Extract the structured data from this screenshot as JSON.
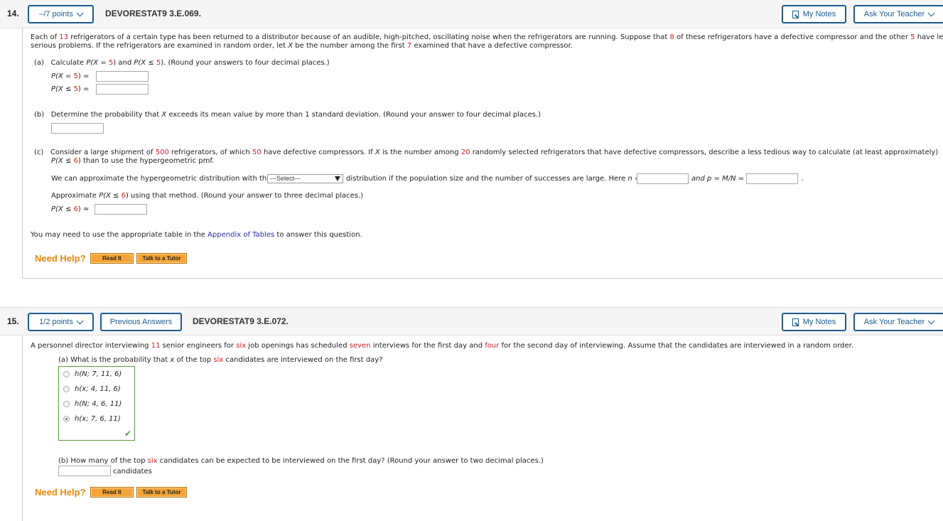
{
  "q14": {
    "number": "14.",
    "points_label": "–/7 points",
    "code": "DEVORESTAT9 3.E.069.",
    "my_notes": "My Notes",
    "ask_teacher": "Ask Your Teacher",
    "intro": {
      "p1": "Each of ",
      "n_total": "13",
      "p2": " refrigerators of a certain type has been returned to a distributor because of an audible, high-pitched, oscillating noise when the refrigerators are running. Suppose that ",
      "n_defective": "8",
      "p3": " of these refrigerators have a defective compressor and the other ",
      "n_other": "5",
      "p4": " have less",
      "line2_a": "serious problems. If the refrigerators are examined in random order, let ",
      "var": "X",
      "line2_b": " be the number among the first ",
      "n_first": "7",
      "line2_c": " examined that have a defective compressor."
    },
    "part_a": {
      "label": "(a)",
      "text_a": "Calculate ",
      "expr1": "P(X = ",
      "val": "5",
      "expr_close": ")",
      "and": " and ",
      "expr2": "P(X ≤ ",
      "text_b": ". (Round your answers to four decimal places.)",
      "row1_label": "P(X = ",
      "row2_label": "P(X ≤ ",
      "eq": ") =",
      "answer1": "",
      "answer2": ""
    },
    "part_b": {
      "label": "(b)",
      "text_a": "Determine the probability that ",
      "var": "X",
      "text_b": " exceeds its mean value by more than 1 standard deviation. (Round your answer to four decimal places.)",
      "answer": ""
    },
    "part_c": {
      "label": "(c)",
      "t1": "Consider a large shipment of ",
      "n_ship": "500",
      "t2": " refrigerators, of which ",
      "n_def": "50",
      "t3": " have defective compressors. If ",
      "var": "X",
      "t4": " is the number among ",
      "n_sel": "20",
      "t5": " randomly selected refrigerators that have defective compressors, describe a less tedious way to calculate (at least approximately)",
      "line2_expr": "P(X ≤ ",
      "line2_val": "6",
      "line2_rest": ") than to use the hypergeometric pmf.",
      "approx_a": "We can approximate the hypergeometric distribution with the",
      "select_value": "---Select---",
      "approx_b": "distribution if the population size and the number of successes are large. Here ",
      "n_label": "n =",
      "p_label": "and p = M/N =",
      "period": ".",
      "approx_line": "Approximate ",
      "approx_line_b": " using that method. (Round your answer to three decimal places.)",
      "approx_expr": "P(X ≤ ",
      "approx_val": "6",
      "approx_sym": ") ≈",
      "n_answer": "",
      "p_answer": "",
      "approx_answer": ""
    },
    "appendix": {
      "text_a": "You may need to use the appropriate table in the ",
      "link": "Appendix of Tables",
      "text_b": " to answer this question."
    },
    "help": {
      "label": "Need Help?",
      "read_it": "Read It",
      "tutor": "Talk to a Tutor"
    }
  },
  "q15": {
    "number": "15.",
    "points_label": "1/2 points",
    "previous_answers": "Previous Answers",
    "code": "DEVORESTAT9 3.E.072.",
    "my_notes": "My Notes",
    "ask_teacher": "Ask Your Teacher",
    "intro": {
      "p1": "A personnel director interviewing ",
      "n": "11",
      "p2": " senior engineers for ",
      "jobs": "six",
      "p3": " job openings has scheduled ",
      "day1": "seven",
      "p4": " interviews for the first day and ",
      "day2": "four",
      "p5": " for the second day of interviewing. Assume that the candidates are interviewed in a random order."
    },
    "part_a": {
      "text_a": "(a) What is the probability that ",
      "var": "x",
      "text_b": " of the top ",
      "top": "six",
      "text_c": " candidates are interviewed on the first day?",
      "options": [
        {
          "label": "h(N; 7, 11, 6)",
          "selected": false
        },
        {
          "label": "h(x; 4, 11, 6)",
          "selected": false
        },
        {
          "label": "h(N; 4, 6, 11)",
          "selected": false
        },
        {
          "label": "h(x; 7, 6, 11)",
          "selected": true
        }
      ],
      "status": "correct"
    },
    "part_b": {
      "text_a": "(b) How many of the top ",
      "top": "six",
      "text_b": " candidates can be expected to be interviewed on the first day? (Round your answer to two decimal places.)",
      "unit": "candidates",
      "answer": ""
    },
    "help": {
      "label": "Need Help?",
      "read_it": "Read It",
      "tutor": "Talk to a Tutor"
    }
  }
}
